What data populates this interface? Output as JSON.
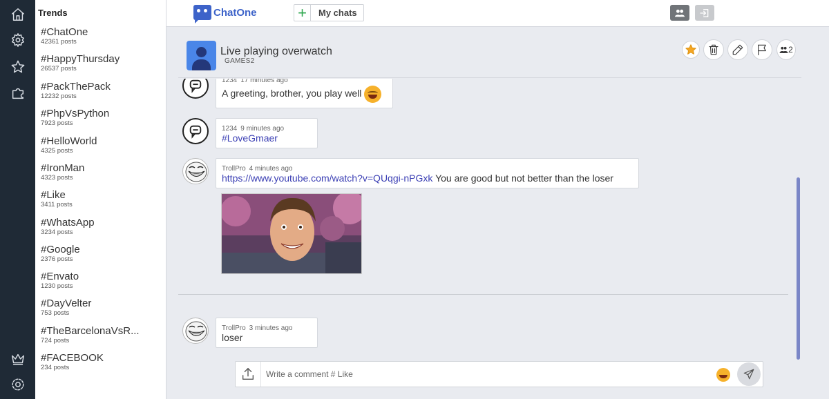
{
  "rail": {
    "icons": [
      "home-icon",
      "settings-gear-icon",
      "star-icon",
      "puzzle-icon",
      "crown-icon",
      "cog-icon"
    ]
  },
  "trends": {
    "title": "Trends",
    "items": [
      {
        "tag": "#ChatOne",
        "count": "42361 posts"
      },
      {
        "tag": "#HappyThursday",
        "count": "26537 posts"
      },
      {
        "tag": "#PackThePack",
        "count": "12232 posts"
      },
      {
        "tag": "#PhpVsPython",
        "count": "7923 posts"
      },
      {
        "tag": "#HelloWorld",
        "count": "4325 posts"
      },
      {
        "tag": "#IronMan",
        "count": "4323 posts"
      },
      {
        "tag": "#Like",
        "count": "3411 posts"
      },
      {
        "tag": "#WhatsApp",
        "count": "3234 posts"
      },
      {
        "tag": "#Google",
        "count": "2376 posts"
      },
      {
        "tag": "#Envato",
        "count": "1230 posts"
      },
      {
        "tag": "#DayVelter",
        "count": "753 posts"
      },
      {
        "tag": "#TheBarcelonaVsR...",
        "count": "724 posts"
      },
      {
        "tag": "#FACEBOOK",
        "count": "234 posts"
      }
    ]
  },
  "topbar": {
    "logo_text": "ChatOne",
    "new_chat_icon": "plus-icon",
    "my_chats_label": "My chats"
  },
  "chat": {
    "title": "Live playing overwatch",
    "subtitle": "GAMES2",
    "member_count": "2"
  },
  "messages": [
    {
      "user": "1234",
      "time": "17 minutes ago",
      "text": "A greeting, brother, you play well",
      "emoji": "grinning-emoji"
    },
    {
      "user": "1234",
      "time": "9 minutes ago",
      "link": "#LoveGmaer"
    },
    {
      "user": "TrollPro",
      "time": "4 minutes ago",
      "link": "https://www.youtube.com/watch?v=QUqgi-nPGxk",
      "text": "You are good but not better than the loser"
    },
    {
      "user": "TrollPro",
      "time": "3 minutes ago",
      "text": "loser"
    }
  ],
  "composer": {
    "placeholder": "Write a comment # Like"
  },
  "colors": {
    "rail": "#1f2a36",
    "brand": "#3d63c9",
    "link": "#3b3fb4",
    "scrollbar": "#7a86c7",
    "star": "#f5a623"
  }
}
